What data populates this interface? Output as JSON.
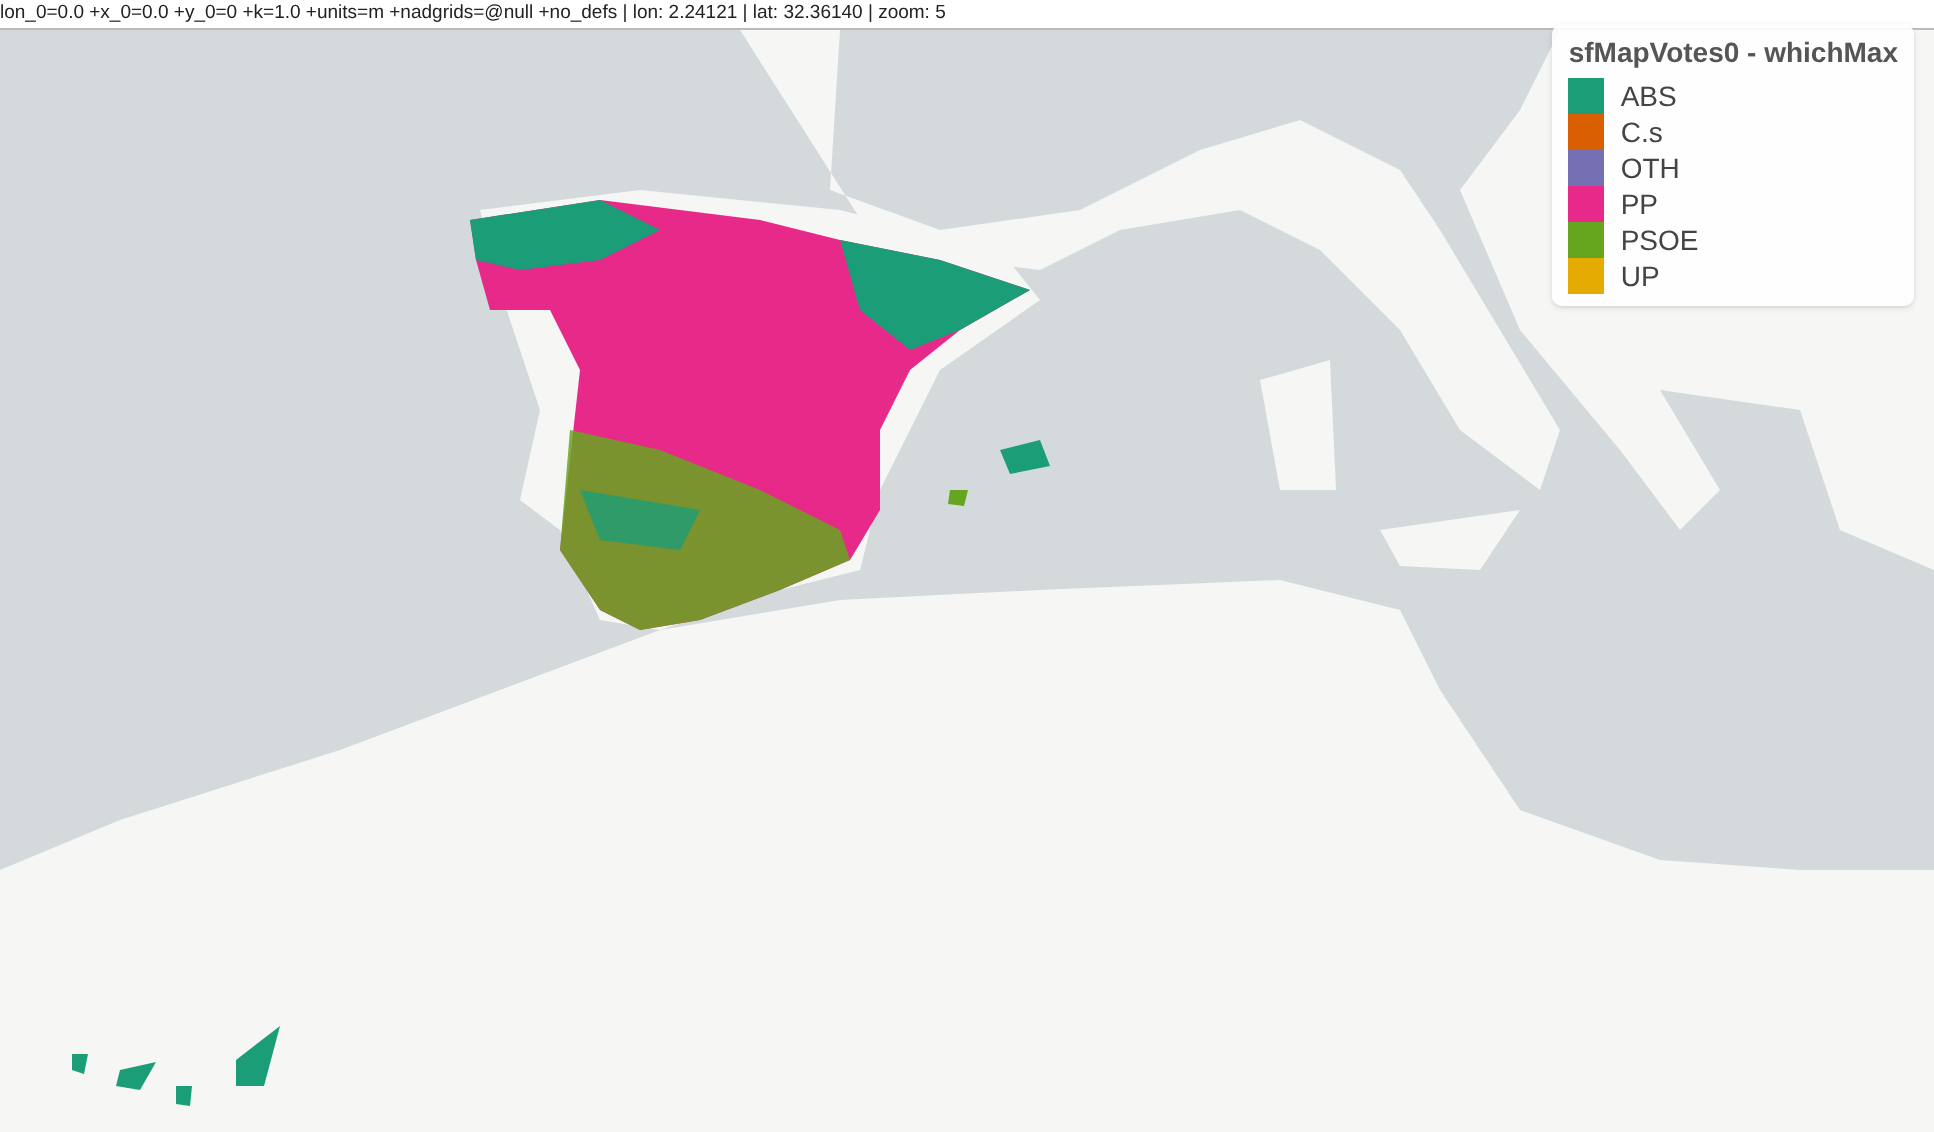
{
  "info_bar": {
    "text": "lon_0=0.0 +x_0=0.0 +y_0=0 +k=1.0 +units=m +nadgrids=@null +no_defs | lon: 2.24121 | lat: 32.36140 | zoom: 5"
  },
  "legend": {
    "title": "sfMapVotes0 - whichMax",
    "items": [
      {
        "label": "ABS",
        "color": "#1b9e77"
      },
      {
        "label": "C.s",
        "color": "#d95f02"
      },
      {
        "label": "OTH",
        "color": "#7570b3"
      },
      {
        "label": "PP",
        "color": "#e7298a"
      },
      {
        "label": "PSOE",
        "color": "#66a61e"
      },
      {
        "label": "UP",
        "color": "#e6ab02"
      }
    ]
  }
}
